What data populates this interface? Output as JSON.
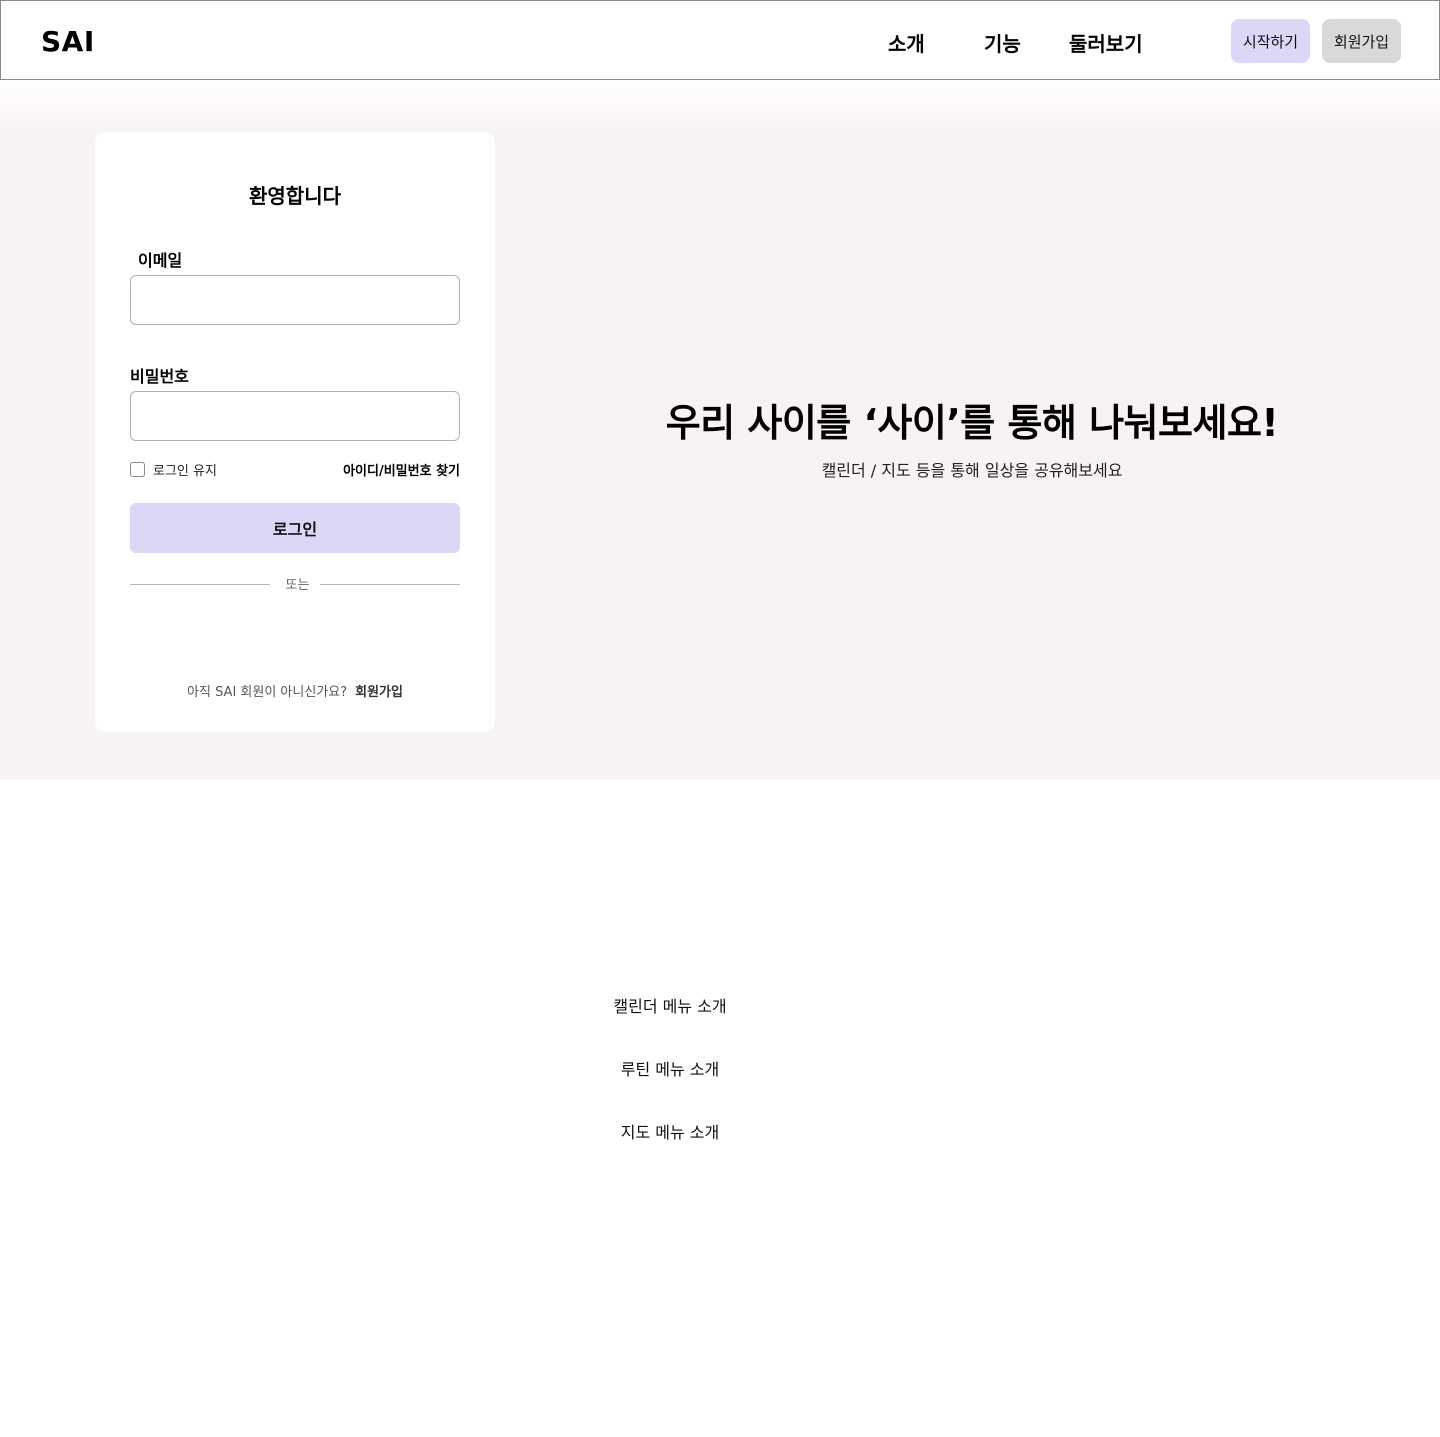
{
  "header": {
    "logo": "SAI",
    "nav": [
      "소개",
      "기능",
      "둘러보기"
    ],
    "start_button": "시작하기",
    "signup_button": "회원가입"
  },
  "login": {
    "title": "환영합니다",
    "email_label": "이메일",
    "email_value": "",
    "password_label": "비밀번호",
    "password_value": "",
    "remember_label": "로그인 유지",
    "remember_checked": false,
    "find_link": "아이디/비밀번호 찾기",
    "login_button": "로그인",
    "divider": "또는",
    "signup_prompt": "아직 SAI 회원이 아니신가요?",
    "signup_link": "회원가입"
  },
  "hero": {
    "title": "우리 사이를 ‘사이’를 통해 나눠보세요!",
    "subtitle": "캘린더 / 지도 등을 통해 일상을 공유해보세요"
  },
  "menu_intro": {
    "items": [
      "캘린더 메뉴 소개",
      "루틴 메뉴 소개",
      "지도 메뉴 소개"
    ]
  },
  "colors": {
    "accent": "#dcd6f7",
    "secondary_button": "#d9d9d9",
    "hero_background": "#f8f2f4"
  }
}
